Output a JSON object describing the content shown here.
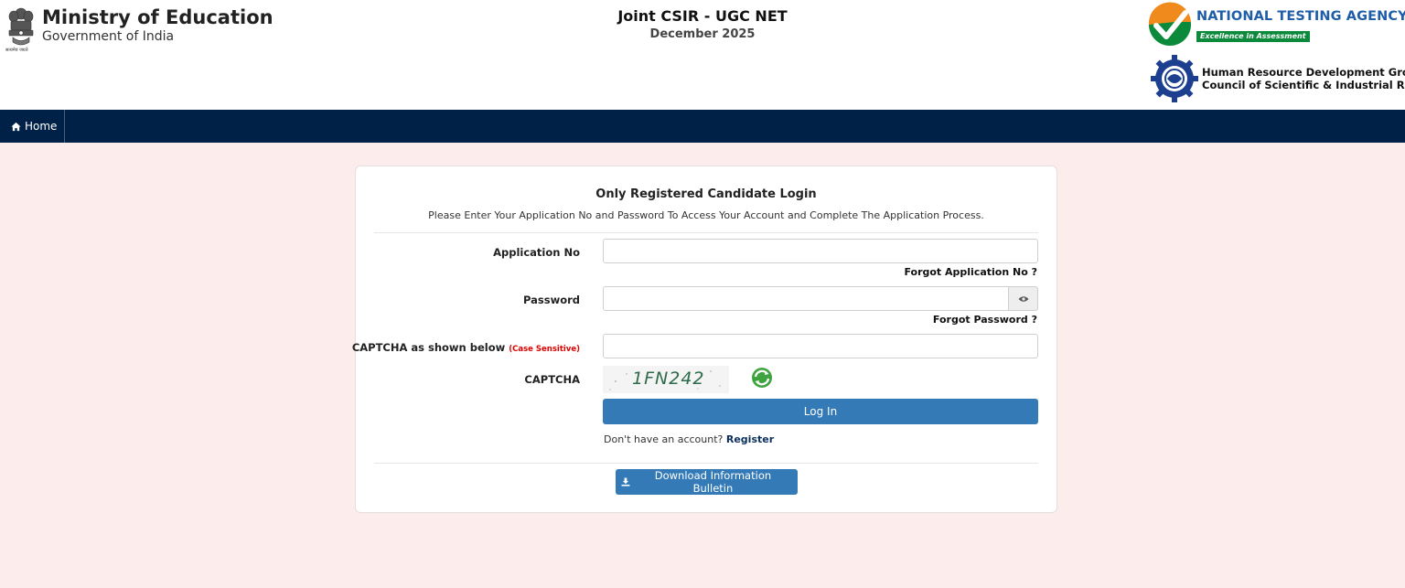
{
  "header": {
    "ministry_title": "Ministry of Education",
    "ministry_subtitle": "Government of India",
    "emblem_caption": "सत्यमेव जयते",
    "exam_title": "Joint CSIR - UGC NET",
    "exam_session": "December 2025",
    "agency_name": "NATIONAL TESTING AGENCY",
    "agency_tagline": "Excellence in Assessment",
    "csir_line1": "Human Resource Development Group",
    "csir_line2": "Council of Scientific & Industrial Research"
  },
  "nav": {
    "home_label": "Home",
    "home_icon": "home-icon"
  },
  "login": {
    "title": "Only Registered Candidate Login",
    "description": "Please Enter Your Application No and Password To Access Your Account and Complete The Application Process.",
    "application_label": "Application No",
    "application_value": "",
    "forgot_application": "Forgot Application No ?",
    "password_label": "Password",
    "password_value": "",
    "forgot_password": "Forgot Password ?",
    "captcha_input_label": "CAPTCHA as shown below",
    "case_sensitive": "(Case Sensitive)",
    "captcha_value": "",
    "captcha_label": "CAPTCHA",
    "captcha_text": "1FN242",
    "login_button": "Log In",
    "no_account": "Don't have an account?",
    "register_link": "Register",
    "download_button": "Download Information Bulletin"
  },
  "colors": {
    "navbar": "#002147",
    "page_background": "#fdecec",
    "primary_button": "#337ab7",
    "agency_blue": "#1f5da8",
    "agency_green": "#0a8a3a",
    "case_sensitive_red": "#e00000"
  }
}
